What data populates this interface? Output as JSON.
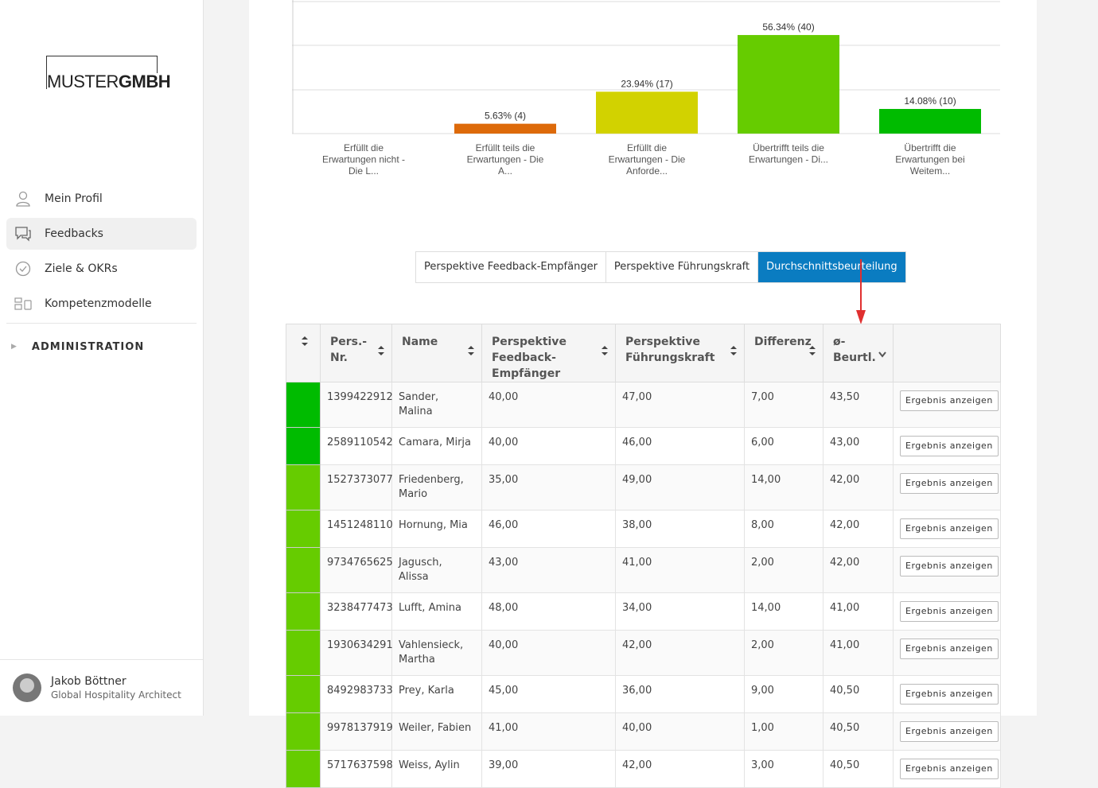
{
  "sidebar": {
    "logo": {
      "part1": "MUSTER",
      "part2": "GMBH"
    },
    "items": [
      {
        "label": "Mein Profil",
        "icon": "user-icon"
      },
      {
        "label": "Feedbacks",
        "icon": "chat-bubbles-icon"
      },
      {
        "label": "Ziele & OKRs",
        "icon": "check-circle-icon"
      },
      {
        "label": "Kompetenzmodelle",
        "icon": "model-grid-icon"
      }
    ],
    "admin_label": "ADMINISTRATION",
    "user": {
      "name": "Jakob Böttner",
      "role": "Global Hospitality Architect"
    }
  },
  "chart_data": {
    "type": "bar",
    "categories": [
      "Erfüllt die Erwartungen nicht - Die L...",
      "Erfüllt teils die Erwartungen - Die A...",
      "Erfüllt die Erwartungen - Die Anforde...",
      "Übertrifft teils die Erwartungen - Di...",
      "Übertrifft die Erwartungen bei Weitem..."
    ],
    "values": [
      0,
      5.63,
      23.94,
      56.34,
      14.08
    ],
    "data_labels": [
      "",
      "5.63% (4)",
      "23.94% (17)",
      "56.34% (40)",
      "14.08% (10)"
    ],
    "colors": [
      "#cc2b2b",
      "#dd6a0a",
      "#d2d200",
      "#66cc00",
      "#00bb00"
    ],
    "ylim": [
      0,
      60
    ],
    "grid": true
  },
  "tabs": [
    {
      "label": "Perspektive Feedback-Empfänger",
      "active": false
    },
    {
      "label": "Perspektive Führungskraft",
      "active": false
    },
    {
      "label": "Durchschnittsbeurteilung",
      "active": true
    }
  ],
  "table": {
    "headers": [
      "",
      "Pers.-Nr.",
      "Name",
      "Perspektive Feedback-Empfänger",
      "Perspektive Führungskraft",
      "Differenz",
      "ø-Beurtl.",
      ""
    ],
    "header_html": [
      "",
      "Pers.-<br>Nr.",
      "Name",
      "Perspektive<br>Feedback-<br>Empfänger",
      "Perspektive<br>Führungskraft",
      "Differenz",
      "ø-<br>Beurtl.",
      ""
    ],
    "button_label": "Ergebnis anzeigen",
    "rows": [
      {
        "color": "#00bb00",
        "nr": "1399422912",
        "name": "Sander, Malina",
        "fe": "40,00",
        "fk": "47,00",
        "diff": "7,00",
        "avg": "43,50"
      },
      {
        "color": "#00bb00",
        "nr": "2589110542",
        "name": "Camara, Mirja",
        "fe": "40,00",
        "fk": "46,00",
        "diff": "6,00",
        "avg": "43,00"
      },
      {
        "color": "#66cc00",
        "nr": "1527373077",
        "name": "Friedenberg, Mario",
        "fe": "35,00",
        "fk": "49,00",
        "diff": "14,00",
        "avg": "42,00"
      },
      {
        "color": "#66cc00",
        "nr": "1451248110",
        "name": "Hornung, Mia",
        "fe": "46,00",
        "fk": "38,00",
        "diff": "8,00",
        "avg": "42,00"
      },
      {
        "color": "#66cc00",
        "nr": "9734765625",
        "name": "Jagusch, Alissa",
        "fe": "43,00",
        "fk": "41,00",
        "diff": "2,00",
        "avg": "42,00"
      },
      {
        "color": "#66cc00",
        "nr": "3238477473",
        "name": "Lufft, Amina",
        "fe": "48,00",
        "fk": "34,00",
        "diff": "14,00",
        "avg": "41,00"
      },
      {
        "color": "#66cc00",
        "nr": "1930634291",
        "name": "Vahlensieck, Martha",
        "fe": "40,00",
        "fk": "42,00",
        "diff": "2,00",
        "avg": "41,00"
      },
      {
        "color": "#66cc00",
        "nr": "8492983733",
        "name": "Prey, Karla",
        "fe": "45,00",
        "fk": "36,00",
        "diff": "9,00",
        "avg": "40,50"
      },
      {
        "color": "#66cc00",
        "nr": "9978137919",
        "name": "Weiler, Fabien",
        "fe": "41,00",
        "fk": "40,00",
        "diff": "1,00",
        "avg": "40,50"
      },
      {
        "color": "#66cc00",
        "nr": "5717637598",
        "name": "Weiss, Aylin",
        "fe": "39,00",
        "fk": "42,00",
        "diff": "3,00",
        "avg": "40,50"
      }
    ]
  },
  "annotation": {
    "arrow_color": "#e03030"
  }
}
